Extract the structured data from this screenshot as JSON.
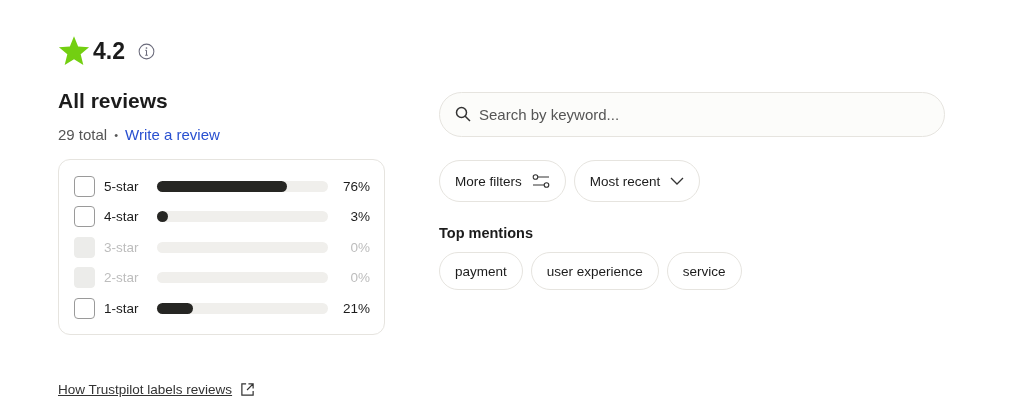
{
  "rating": {
    "score": "4.2"
  },
  "title": "All reviews",
  "summary": {
    "total": "29 total",
    "separator": "•",
    "write_link": "Write a review"
  },
  "distribution": [
    {
      "label": "5-star",
      "level": 0.76,
      "percent": "76%",
      "checked": false,
      "disabled": false
    },
    {
      "label": "4-star",
      "level": 0.03,
      "percent": "3%",
      "checked": false,
      "disabled": false
    },
    {
      "label": "3-star",
      "percent": "0%",
      "checked": false,
      "disabled": true
    },
    {
      "label": "2-star",
      "percent": "0%",
      "checked": false,
      "disabled": true
    },
    {
      "label": "1-star",
      "level": 0.21,
      "percent": "21%",
      "checked": false,
      "disabled": false
    }
  ],
  "footer_link": "How Trustpilot labels reviews",
  "search": {
    "placeholder": "Search by keyword..."
  },
  "filters": [
    {
      "label": "More filters",
      "kind": "filters"
    },
    {
      "label": "Most recent",
      "kind": "dropdown"
    }
  ],
  "top_mentions": {
    "title": "Top mentions",
    "chips": [
      "payment",
      "user experience",
      "service"
    ]
  }
}
